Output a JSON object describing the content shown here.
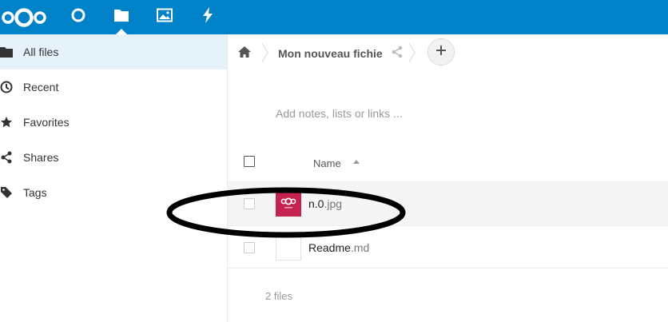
{
  "header": {
    "logo_icon": "nextcloud-logo-icon",
    "apps": [
      {
        "name": "dashboard",
        "icon": "circle-icon"
      },
      {
        "name": "files",
        "icon": "folder-icon",
        "active": true
      },
      {
        "name": "photos",
        "icon": "image-icon"
      },
      {
        "name": "activity",
        "icon": "lightning-icon"
      }
    ],
    "color": "#0082c9"
  },
  "sidebar": {
    "items": [
      {
        "label": "All files",
        "icon": "folder-icon",
        "active": true
      },
      {
        "label": "Recent",
        "icon": "clock-icon"
      },
      {
        "label": "Favorites",
        "icon": "star-icon"
      },
      {
        "label": "Shares",
        "icon": "share-icon"
      },
      {
        "label": "Tags",
        "icon": "tag-icon"
      }
    ]
  },
  "breadcrumb": {
    "home_icon": "home-icon",
    "folder": "Mon nouveau fichie",
    "share_icon": "share-icon",
    "add_icon": "plus-icon"
  },
  "notes": {
    "placeholder": "Add notes, lists or links ..."
  },
  "table": {
    "column_name": "Name",
    "sort_icon": "sort-ascending-icon",
    "rows": [
      {
        "basename": "n.0",
        "ext": ".jpg",
        "thumb": "image-thumbnail"
      },
      {
        "basename": "Readme",
        "ext": ".md",
        "thumb": "file-icon"
      }
    ]
  },
  "summary": "2 files"
}
